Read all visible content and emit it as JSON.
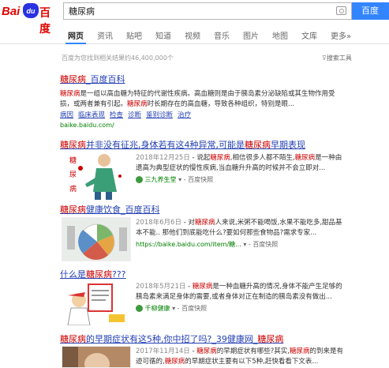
{
  "header": {
    "logo_bai": "Bai",
    "logo_du": "du",
    "logo_baike": "百度",
    "search_value": "糖尿病",
    "search_button": "百度"
  },
  "tabs": [
    {
      "label": "网页"
    },
    {
      "label": "资讯"
    },
    {
      "label": "贴吧"
    },
    {
      "label": "知道"
    },
    {
      "label": "视频"
    },
    {
      "label": "音乐"
    },
    {
      "label": "图片"
    },
    {
      "label": "地图"
    },
    {
      "label": "文库"
    },
    {
      "label": "更多»"
    }
  ],
  "result_count": "百度为您找到相关结果约46,400,000个",
  "search_tools": "搜索工具",
  "results": [
    {
      "title_em": "糖尿病",
      "title_rest": "_百度百科",
      "line1_em": "糖尿病",
      "line1": "是一组以高血糖为特征的代谢性疾病。高血糖则是由于胰岛素分泌缺陷或其生物作用受",
      "line2_pre": "损，或两者兼有引起。",
      "line2_em": "糖尿病",
      "line2": "时长期存在的高血糖，导致各种组织，特别是眼...",
      "links": [
        "病因",
        "临床表现",
        "检查",
        "诊断",
        "鉴别诊断",
        "治疗"
      ],
      "url": "baike.baidu.com/"
    },
    {
      "title_em1": "糖尿病",
      "title_mid": "并非没有征兆,身体若有这4种异常,可能是",
      "title_em2": "糖尿病",
      "title_rest": "早期表现",
      "date": "2018年12月25日",
      "line1_pre": " - 说起",
      "line1_em1": "糖尿病",
      "line1_mid": ",相信很多人都不陌生,",
      "line1_em2": "糖尿病",
      "line1": "是一种由",
      "line2": "遗高为典型症状的慢性疾病,当血糖升升高的时候并不会立即对...",
      "source": "三九养生堂",
      "snapshot": "百度快照",
      "thumb_text": [
        "糖",
        "尿",
        "病"
      ]
    },
    {
      "title_em": "糖尿病",
      "title_rest": "健康饮食_百度百科",
      "date": "2018年6月6日",
      "line1_pre": " - 对",
      "line1_em": "糖尿病",
      "line1": "人来说,米粥不能喝饭,水果不能吃多,甜品基",
      "line2": "本不能.. 那他们到底能吃什么?要如何那些食物品?需求专家...",
      "url": "https://baike.baidu.com/item/糖...",
      "snapshot": "百度快照"
    },
    {
      "title_pre": "什么是",
      "title_em": "糖尿病",
      "title_rest": "???",
      "date": "2018年5月21日",
      "line1_pre": " - ",
      "line1_em": "糖尿病",
      "line1": "是一种血糖升高的情况,身体不能产生足够的",
      "line2": "胰岛素来满足身体的需要,或者身体对正在制造的胰岛素没有做出...",
      "source": "千柳健康",
      "snapshot": "百度快照"
    },
    {
      "title_em1": "糖尿病",
      "title_mid": "的早期症状有这5种,你中招了吗?_39健康网_",
      "title_em2": "糖尿病",
      "date": "2017年11月14日",
      "line1_pre": " - ",
      "line1_em1": "糖尿病",
      "line1_mid": "的早期症状有哪些?其实,",
      "line1_em2": "糖尿病",
      "line1": "的到来是有",
      "line2_pre": "迹可循的,",
      "line2_em": "糖尿病",
      "line2": "的早期症状主要有以下5种,赶快看看下文表..."
    }
  ]
}
